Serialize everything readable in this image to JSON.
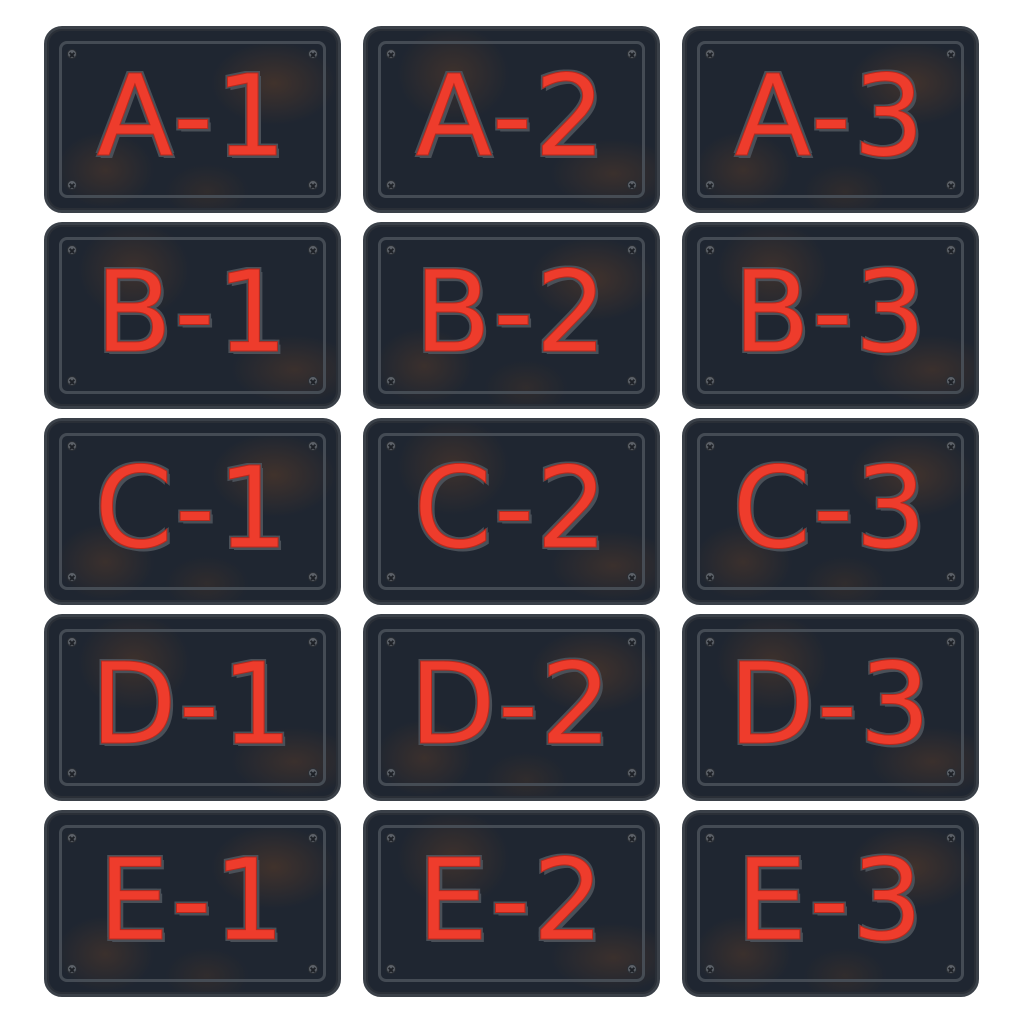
{
  "plates": [
    {
      "label": "A-1"
    },
    {
      "label": "A-2"
    },
    {
      "label": "A-3"
    },
    {
      "label": "B-1"
    },
    {
      "label": "B-2"
    },
    {
      "label": "B-3"
    },
    {
      "label": "C-1"
    },
    {
      "label": "C-2"
    },
    {
      "label": "C-3"
    },
    {
      "label": "D-1"
    },
    {
      "label": "D-2"
    },
    {
      "label": "D-3"
    },
    {
      "label": "E-1"
    },
    {
      "label": "E-2"
    },
    {
      "label": "E-3"
    }
  ],
  "colors": {
    "plate": "#1f2631",
    "text": "#ee3c2c",
    "frame": "#4b525b",
    "rust": "#5c3c28"
  },
  "icons": {
    "screw": "screw-icon"
  }
}
